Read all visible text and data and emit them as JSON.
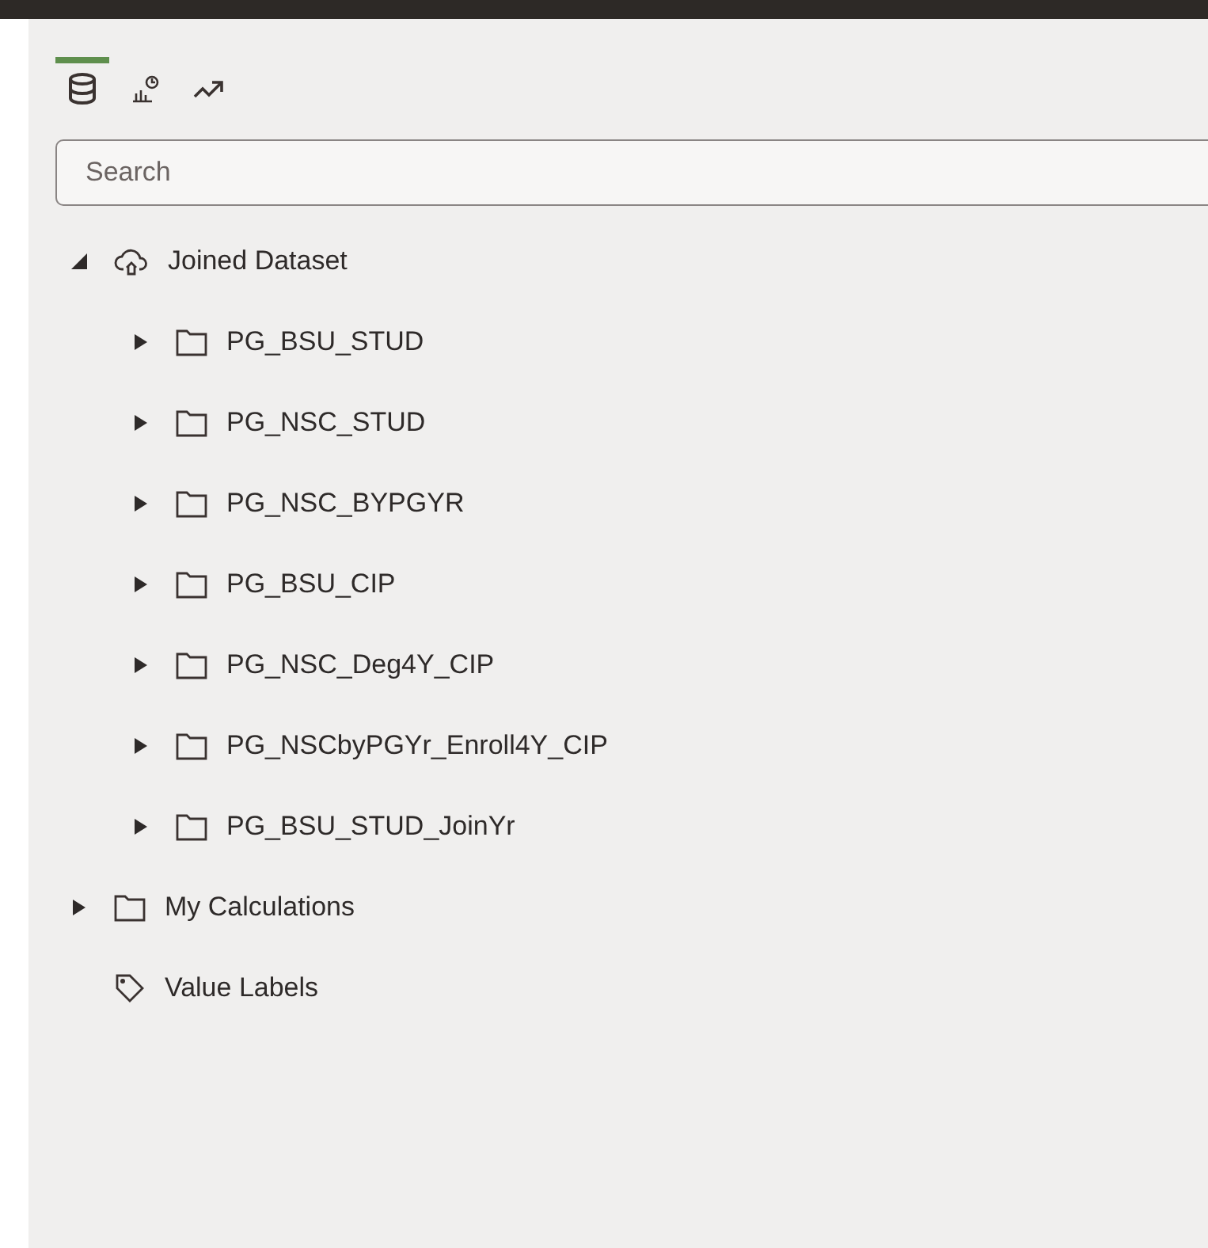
{
  "tabs": [
    {
      "kind": "data",
      "selected": true
    },
    {
      "kind": "visualizations",
      "selected": false
    },
    {
      "kind": "analytics",
      "selected": false
    }
  ],
  "search": {
    "placeholder": "Search"
  },
  "tree": [
    {
      "label": "Joined Dataset",
      "kind": "dataset",
      "expanded": true,
      "children": [
        {
          "label": "PG_BSU_STUD",
          "kind": "folder",
          "expanded": false
        },
        {
          "label": "PG_NSC_STUD",
          "kind": "folder",
          "expanded": false
        },
        {
          "label": "PG_NSC_BYPGYR",
          "kind": "folder",
          "expanded": false
        },
        {
          "label": "PG_BSU_CIP",
          "kind": "folder",
          "expanded": false
        },
        {
          "label": "PG_NSC_Deg4Y_CIP",
          "kind": "folder",
          "expanded": false
        },
        {
          "label": "PG_NSCbyPGYr_Enroll4Y_CIP",
          "kind": "folder",
          "expanded": false
        },
        {
          "label": "PG_BSU_STUD_JoinYr",
          "kind": "folder",
          "expanded": false
        }
      ]
    },
    {
      "label": "My Calculations",
      "kind": "folder",
      "expanded": false
    },
    {
      "label": "Value Labels",
      "kind": "labels"
    }
  ]
}
